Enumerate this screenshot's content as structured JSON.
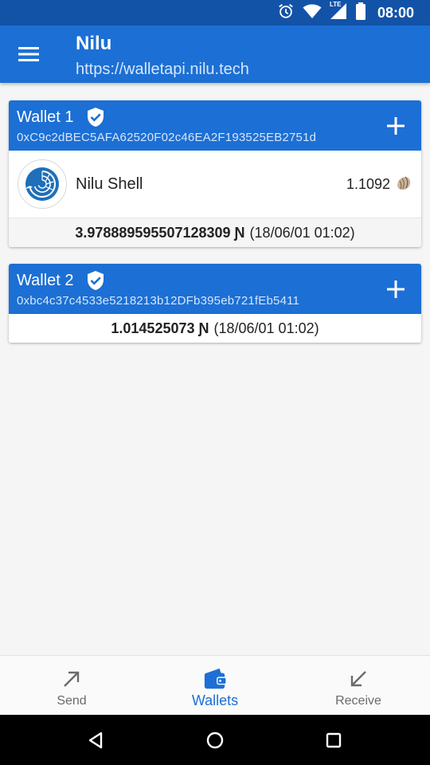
{
  "status_bar": {
    "time": "08:00",
    "network": "LTE",
    "icons": [
      "alarm-icon",
      "wifi-icon",
      "signal-icon",
      "battery-icon"
    ]
  },
  "app_bar": {
    "title": "Nilu",
    "subtitle": "https://walletapi.nilu.tech",
    "menu_icon": "hamburger-menu-icon"
  },
  "wallets": [
    {
      "name": "Wallet 1",
      "address": "0xC9c2dBEC5AFA62520F02c46EA2F193525EB2751d",
      "verified": true,
      "tokens": [
        {
          "name": "Nilu Shell",
          "balance": "1.1092",
          "icon": "nautilus-logo-icon",
          "unit_icon": "shell-icon"
        }
      ],
      "total": "3.978889595507128309 Ɲ",
      "date": "(18/06/01 01:02)"
    },
    {
      "name": "Wallet 2",
      "address": "0xbc4c37c4533e5218213b12DFb395eb721fEb5411",
      "verified": true,
      "tokens": [],
      "total": "1.014525073 Ɲ",
      "date": "(18/06/01 01:02)"
    }
  ],
  "bottom_nav": {
    "items": [
      {
        "label": "Send",
        "icon": "arrow-up-right-icon",
        "active": false
      },
      {
        "label": "Wallets",
        "icon": "wallet-icon",
        "active": true
      },
      {
        "label": "Receive",
        "icon": "arrow-down-left-icon",
        "active": false
      }
    ]
  },
  "colors": {
    "primary": "#1c6fd4",
    "primary_dark": "#1253a8",
    "background": "#f5f5f5"
  }
}
